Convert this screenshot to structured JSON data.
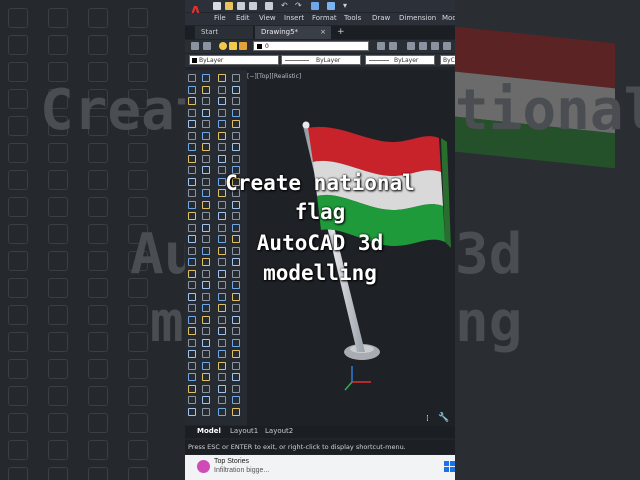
{
  "app": {
    "logo": "A",
    "menu": [
      "File",
      "Edit",
      "View",
      "Insert",
      "Format",
      "Tools",
      "Draw",
      "Dimension",
      "Mod"
    ],
    "tabs": {
      "start": "Start",
      "drawing": "Drawing5*",
      "close": "×",
      "add": "+"
    },
    "layer_value": "0",
    "properties": [
      "ByLayer",
      "ByLayer",
      "ByLayer",
      "ByC"
    ],
    "viewport_label": "[−][Top][Realistic]",
    "layout_tabs": [
      "Model",
      "Layout1",
      "Layout2"
    ],
    "command_prompt": "Press ESC or ENTER to exit, or right-click to display shortcut-menu."
  },
  "overlay": {
    "lines": [
      "Create national",
      "flag",
      "AutoCAD 3d",
      "modelling"
    ]
  },
  "taskbar": {
    "news_title": "Top Stories",
    "news_subtitle": "Infiltration bigge..."
  },
  "background_text": [
    "Create na",
    "tional",
    "Au",
    "3d",
    "m",
    "ng"
  ],
  "colors": {
    "flag_red": "#c8232a",
    "flag_white": "#d9d9d9",
    "flag_green": "#1f9a3a",
    "accent_blue": "#2f7bd6",
    "logo_red": "#e03030"
  }
}
